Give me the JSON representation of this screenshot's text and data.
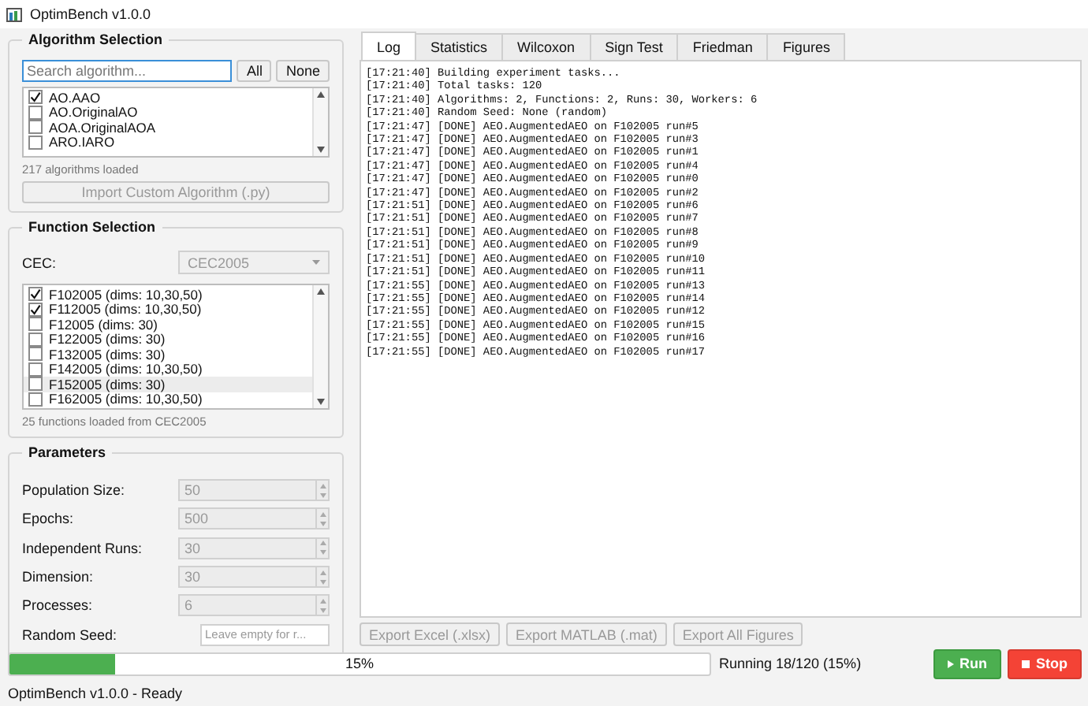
{
  "window": {
    "title": "OptimBench v1.0.0"
  },
  "algorithm_selection": {
    "title": "Algorithm Selection",
    "search": {
      "placeholder": "Search algorithm..."
    },
    "buttons": [
      "All",
      "None"
    ],
    "items": [
      {
        "label": "AO.AAO",
        "checked": true
      },
      {
        "label": "AO.OriginalAO",
        "checked": false
      },
      {
        "label": "AOA.OriginalAOA",
        "checked": false
      },
      {
        "label": "ARO.IARO",
        "checked": false
      }
    ],
    "count_label": "217 algorithms loaded",
    "import_button": "Import Custom Algorithm (.py)"
  },
  "function_selection": {
    "title": "Function Selection",
    "cec_label": "CEC:",
    "cec_value": "CEC2005",
    "items": [
      {
        "label": "F102005 (dims: 10,30,50)",
        "checked": true,
        "selected": false
      },
      {
        "label": "F112005 (dims: 10,30,50)",
        "checked": true,
        "selected": false
      },
      {
        "label": "F12005 (dims: 30)",
        "checked": false,
        "selected": false
      },
      {
        "label": "F122005 (dims: 30)",
        "checked": false,
        "selected": false
      },
      {
        "label": "F132005 (dims: 30)",
        "checked": false,
        "selected": false
      },
      {
        "label": "F142005 (dims: 10,30,50)",
        "checked": false,
        "selected": false
      },
      {
        "label": "F152005 (dims: 30)",
        "checked": false,
        "selected": true
      },
      {
        "label": "F162005 (dims: 10,30,50)",
        "checked": false,
        "selected": false
      }
    ],
    "count_label": "25 functions loaded from CEC2005"
  },
  "parameters": {
    "title": "Parameters",
    "fields": [
      {
        "label": "Population Size:",
        "value": "50",
        "kind": "spin"
      },
      {
        "label": "Epochs:",
        "value": "500",
        "kind": "spin"
      },
      {
        "label": "Independent Runs:",
        "value": "30",
        "kind": "spin"
      },
      {
        "label": "Dimension:",
        "value": "30",
        "kind": "spin"
      },
      {
        "label": "Processes:",
        "value": "6",
        "kind": "spin"
      },
      {
        "label": "Random Seed:",
        "placeholder": "Leave empty for r...",
        "kind": "text"
      }
    ]
  },
  "tabs": [
    {
      "label": "Log",
      "selected": true
    },
    {
      "label": "Statistics",
      "selected": false
    },
    {
      "label": "Wilcoxon",
      "selected": false
    },
    {
      "label": "Sign Test",
      "selected": false
    },
    {
      "label": "Friedman",
      "selected": false
    },
    {
      "label": "Figures",
      "selected": false
    }
  ],
  "log": [
    "[17:21:40] Building experiment tasks...",
    "[17:21:40] Total tasks: 120",
    "[17:21:40] Algorithms: 2, Functions: 2, Runs: 30, Workers: 6",
    "[17:21:40] Random Seed: None (random)",
    "[17:21:47] [DONE] AEO.AugmentedAEO on F102005 run#5",
    "[17:21:47] [DONE] AEO.AugmentedAEO on F102005 run#3",
    "[17:21:47] [DONE] AEO.AugmentedAEO on F102005 run#1",
    "[17:21:47] [DONE] AEO.AugmentedAEO on F102005 run#4",
    "[17:21:47] [DONE] AEO.AugmentedAEO on F102005 run#0",
    "[17:21:47] [DONE] AEO.AugmentedAEO on F102005 run#2",
    "[17:21:51] [DONE] AEO.AugmentedAEO on F102005 run#6",
    "[17:21:51] [DONE] AEO.AugmentedAEO on F102005 run#7",
    "[17:21:51] [DONE] AEO.AugmentedAEO on F102005 run#8",
    "[17:21:51] [DONE] AEO.AugmentedAEO on F102005 run#9",
    "[17:21:51] [DONE] AEO.AugmentedAEO on F102005 run#10",
    "[17:21:51] [DONE] AEO.AugmentedAEO on F102005 run#11",
    "[17:21:55] [DONE] AEO.AugmentedAEO on F102005 run#13",
    "[17:21:55] [DONE] AEO.AugmentedAEO on F102005 run#14",
    "[17:21:55] [DONE] AEO.AugmentedAEO on F102005 run#12",
    "[17:21:55] [DONE] AEO.AugmentedAEO on F102005 run#15",
    "[17:21:55] [DONE] AEO.AugmentedAEO on F102005 run#16",
    "[17:21:55] [DONE] AEO.AugmentedAEO on F102005 run#17"
  ],
  "export_buttons": [
    "Export Excel (.xlsx)",
    "Export MATLAB (.mat)",
    "Export All Figures"
  ],
  "progress": {
    "level": 0.15,
    "text": "15%"
  },
  "run_status": "Running 18/120 (15%)",
  "run_button": "Run",
  "stop_button": "Stop",
  "status_bar": "OptimBench v1.0.0 - Ready"
}
